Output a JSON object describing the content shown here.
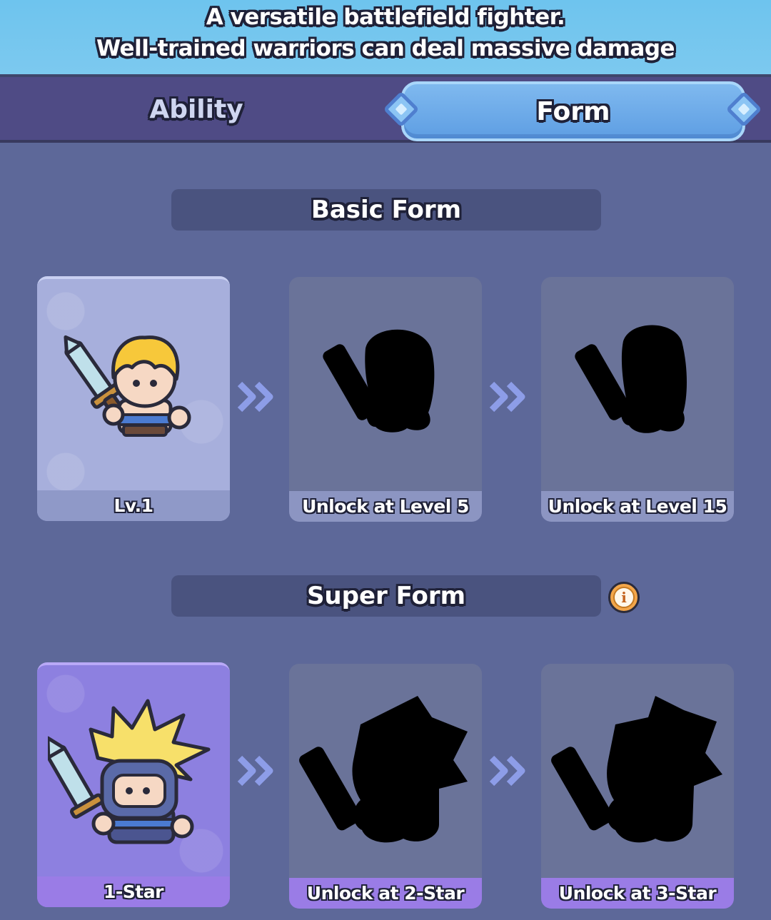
{
  "header": {
    "line1": "A versatile battlefield fighter.",
    "line2": "Well-trained warriors can deal massive damage"
  },
  "tabs": {
    "ability": "Ability",
    "form": "Form",
    "active": "Form"
  },
  "basic_form": {
    "title": "Basic Form",
    "cards": [
      {
        "label": "Lv.1",
        "unlocked": true
      },
      {
        "label": "Unlock at Level 5",
        "unlocked": false
      },
      {
        "label": "Unlock at Level 15",
        "unlocked": false
      }
    ]
  },
  "super_form": {
    "title": "Super Form",
    "info_icon": "info-icon",
    "cards": [
      {
        "label": "1-Star",
        "unlocked": true
      },
      {
        "label": "Unlock at 2-Star",
        "unlocked": false
      },
      {
        "label": "Unlock at 3-Star",
        "unlocked": false
      }
    ]
  },
  "colors": {
    "background": "#5d6899",
    "header": "#7cc9ef",
    "tab_active": "#6aa8ea",
    "super_accent": "#9a7ce6",
    "arrow": "#8d9de8"
  }
}
